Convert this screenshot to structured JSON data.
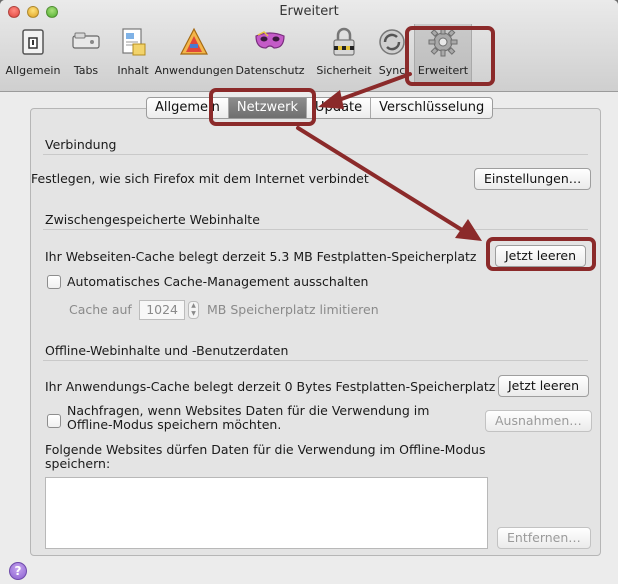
{
  "window": {
    "title": "Erweitert"
  },
  "toolbar": {
    "items": [
      {
        "label": "Allgemein",
        "icon": "switch-icon"
      },
      {
        "label": "Tabs",
        "icon": "tabs-icon"
      },
      {
        "label": "Inhalt",
        "icon": "content-icon"
      },
      {
        "label": "Anwendungen",
        "icon": "applications-icon"
      },
      {
        "label": "Datenschutz",
        "icon": "mask-icon"
      },
      {
        "label": "Sicherheit",
        "icon": "lock-icon"
      },
      {
        "label": "Sync",
        "icon": "sync-icon"
      },
      {
        "label": "Erweitert",
        "icon": "gear-icon",
        "selected": true
      }
    ]
  },
  "tabs": [
    {
      "label": "Allgemein",
      "active": false
    },
    {
      "label": "Netzwerk",
      "active": true
    },
    {
      "label": "Update",
      "active": false
    },
    {
      "label": "Verschlüsselung",
      "active": false
    }
  ],
  "connection": {
    "title": "Verbindung",
    "description": "Festlegen, wie sich Firefox mit dem Internet verbindet",
    "button": "Einstellungen…"
  },
  "cache": {
    "title": "Zwischengespeicherte Webinhalte",
    "status": "Ihr Webseiten-Cache belegt derzeit 5.3 MB Festplatten-Speicherplatz",
    "clear_button": "Jetzt leeren",
    "override_checkbox": "Automatisches Cache-Management ausschalten",
    "limit_prefix": "Cache auf",
    "limit_value": "1024",
    "limit_suffix": "MB Speicherplatz limitieren"
  },
  "offline": {
    "title": "Offline-Webinhalte und -Benutzerdaten",
    "status": "Ihr Anwendungs-Cache belegt derzeit 0 Bytes Festplatten-Speicherplatz",
    "clear_button": "Jetzt leeren",
    "ask_checkbox_line1": "Nachfragen, wenn Websites Daten für die Verwendung im",
    "ask_checkbox_line2": "Offline-Modus speichern möchten.",
    "exceptions_button": "Ausnahmen…",
    "list_label_line1": "Folgende Websites dürfen Daten für die Verwendung im Offline-Modus",
    "list_label_line2": "speichern:",
    "remove_button": "Entfernen…"
  },
  "help": {
    "label": "?"
  },
  "colors": {
    "annotation": "#8b2a2a",
    "active_tab": "#7c7c7c"
  }
}
